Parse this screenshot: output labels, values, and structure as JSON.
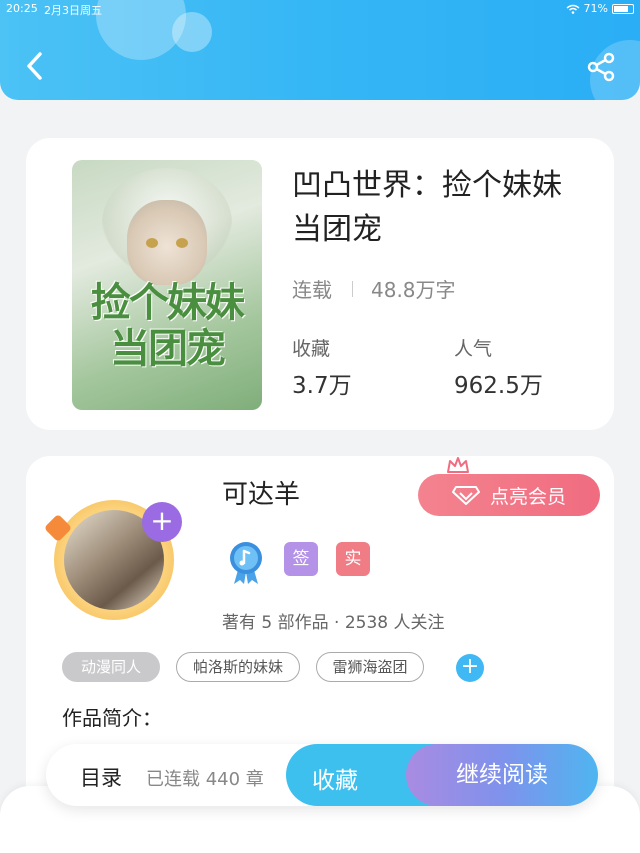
{
  "status_bar": {
    "time": "20:25",
    "date": "2月3日周五",
    "battery": "71%"
  },
  "icons": {
    "back": "chevron-left-icon",
    "share": "share-icon",
    "wifi": "wifi-icon",
    "battery": "battery-icon"
  },
  "book": {
    "title": "凹凸世界：捡个妹妹当团宠",
    "status": "连载",
    "word_count": "48.8万字",
    "favorites_label": "收藏",
    "favorites_value": "3.7万",
    "popularity_label": "人气",
    "popularity_value": "962.5万",
    "cover_title_line1": "捡个妹妹",
    "cover_title_line2": "当团宠"
  },
  "author": {
    "name": "可达羊",
    "vip_label": "点亮会员",
    "badge_sign": "签",
    "badge_real": "实",
    "follow_info": "著有 5 部作品 · 2538 人关注",
    "tags": [
      "动漫同人",
      "帕洛斯的妹妹",
      "雷狮海盗团"
    ]
  },
  "intro": {
    "label": "作品简介："
  },
  "action_bar": {
    "toc_label": "目录",
    "chapter_info": "已连载 440 章",
    "collect_label": "收藏",
    "continue_label": "继续阅读"
  },
  "colors": {
    "header": "#35b6f5",
    "vip": "#f06c80",
    "accent_purple": "#9a6be3",
    "collect": "#3ec0ef"
  }
}
